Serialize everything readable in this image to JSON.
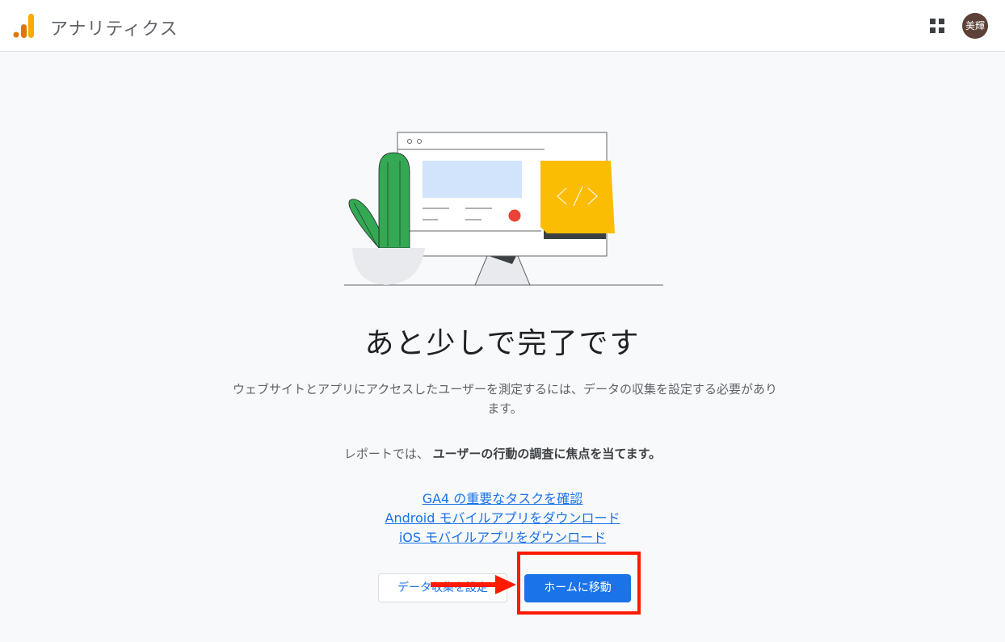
{
  "header": {
    "title": "アナリティクス",
    "logo_icon": "analytics-logo-icon",
    "apps_icon": "apps-grid-icon",
    "avatar_text": "美輝"
  },
  "main": {
    "headline": "あと少しで完了です",
    "description": "ウェブサイトとアプリにアクセスしたユーザーを測定するには、データの収集を設定する必要があります。",
    "report_prefix": "レポートでは、",
    "report_bold": "ユーザーの行動の調査に焦点を当てます。",
    "links": [
      "GA4 の重要なタスクを確認",
      "Android モバイルアプリをダウンロード",
      "iOS モバイルアプリをダウンロード"
    ],
    "buttons": {
      "setup_label": "データ収集を設定",
      "home_label": "ホームに移動"
    }
  },
  "colors": {
    "accent": "#1a73e8",
    "highlight": "#ff1a00",
    "logo_orange": "#f9ab00",
    "logo_dark_orange": "#e37400"
  }
}
